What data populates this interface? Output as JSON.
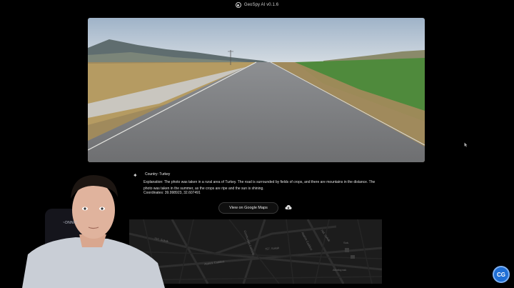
{
  "app": {
    "title": "GeoSpy AI v0.1.6"
  },
  "result": {
    "country": "Country: Turkey",
    "explanation": "Explanation: The photo was taken in a rural area of Turkey. The road is surrounded by fields of crops, and there are mountains in the distance. The photo was taken in the summer, as the crops are ripe and the sun is shining.",
    "coordinates": "Coordinates: 39.998923, 32.607491"
  },
  "actions": {
    "maps_button": "View on Google Maps"
  },
  "map": {
    "labels": [
      "757. Sokak",
      "Cumhuriyet Caddesi",
      "757. Sokak",
      "Atatürk Caddesi",
      "764. Sokak",
      "Sok.",
      "Atatürk Caddesi",
      "Altıntoprak"
    ]
  },
  "webcam": {
    "chair_text": "~DNNIC"
  },
  "badge": {
    "text": "CG"
  },
  "colors": {
    "accent": "#1f6ed4",
    "background": "#000000"
  }
}
